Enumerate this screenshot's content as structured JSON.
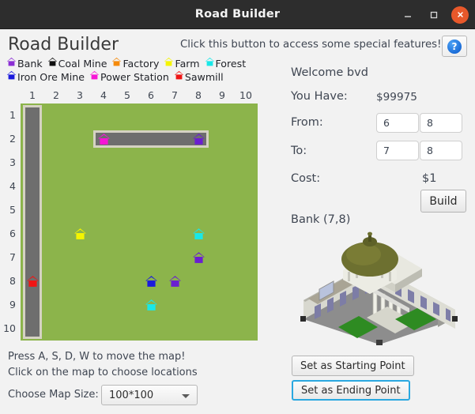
{
  "window": {
    "title": "Road Builder",
    "minimize_icon": "minimize-icon",
    "maximize_icon": "maximize-icon",
    "close_icon": "close-icon"
  },
  "header": {
    "app_title": "Road Builder",
    "help_text": "Click this button to access some special features!",
    "help_button_glyph": "?"
  },
  "legend": {
    "row1": [
      {
        "label": "Bank",
        "color": "#8b2fd4"
      },
      {
        "label": "Coal Mine",
        "color": "#101010"
      },
      {
        "label": "Factory",
        "color": "#f58a0b"
      },
      {
        "label": "Farm",
        "color": "#f5f500"
      },
      {
        "label": "Forest",
        "color": "#19e8e8"
      }
    ],
    "row2": [
      {
        "label": "Iron Ore Mine",
        "color": "#1b1bdd"
      },
      {
        "label": "Power Station",
        "color": "#f715d6"
      },
      {
        "label": "Sawmill",
        "color": "#ef1515"
      }
    ]
  },
  "map": {
    "column_headers": [
      "1",
      "2",
      "3",
      "4",
      "5",
      "6",
      "7",
      "8",
      "9",
      "10"
    ],
    "row_headers": [
      "1",
      "2",
      "3",
      "4",
      "5",
      "6",
      "7",
      "8",
      "9",
      "10"
    ],
    "grass_color": "#8cb44b",
    "road_color": "#6e6e6e",
    "road_border_color": "#d5d2c3",
    "roads": [
      {
        "type": "vertical",
        "col": 1,
        "row_start": 1,
        "row_end": 10
      },
      {
        "type": "horizontal",
        "row": 2,
        "col_start": 4,
        "col_end": 8
      }
    ],
    "buildings": [
      {
        "type": "Power Station",
        "col": 4,
        "row": 2,
        "color": "#f715d6"
      },
      {
        "type": "Bank",
        "col": 8,
        "row": 2,
        "color": "#6a1fd0"
      },
      {
        "type": "Farm",
        "col": 3,
        "row": 6,
        "color": "#f5f500"
      },
      {
        "type": "Forest",
        "col": 8,
        "row": 6,
        "color": "#19e8e8"
      },
      {
        "type": "Bank",
        "col": 8,
        "row": 7,
        "color": "#6a1fd0"
      },
      {
        "type": "Sawmill",
        "col": 1,
        "row": 8,
        "color": "#ef1515"
      },
      {
        "type": "Iron Ore Mine",
        "col": 6,
        "row": 8,
        "color": "#1b1bdd"
      },
      {
        "type": "Bank",
        "col": 7,
        "row": 8,
        "color": "#6a1fd0"
      },
      {
        "type": "Forest",
        "col": 6,
        "row": 9,
        "color": "#19e8e8"
      }
    ]
  },
  "hints": {
    "move_map": "Press A, S, D, W to move the map!",
    "click_map": "Click on the map to choose locations",
    "map_size_label": "Choose Map Size:",
    "map_size_value": "100*100",
    "map_size_options": [
      "100*100"
    ]
  },
  "panel": {
    "welcome": "Welcome bvd",
    "have_label": "You Have:",
    "have_value": "$99975",
    "from_label": "From:",
    "from_x": "6",
    "from_y": "8",
    "to_label": "To:",
    "to_x": "7",
    "to_y": "8",
    "cost_label": "Cost:",
    "cost_value": "$1",
    "build_label": "Build",
    "selected_building": "Bank (7,8)",
    "set_start_label": "Set as Starting Point",
    "set_end_label": "Set as Ending Point"
  }
}
